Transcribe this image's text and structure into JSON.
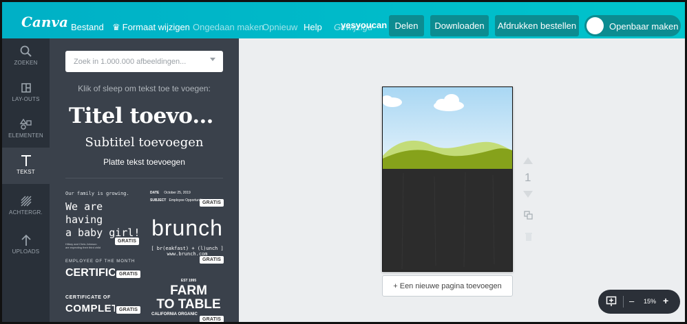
{
  "app": {
    "logo": "Canva"
  },
  "menu": {
    "file": "Bestand",
    "resize": "Formaat wijzigen",
    "undo": "Ongedaan maken",
    "redo": "Opnieuw",
    "help": "Help",
    "saved_status": "Gewijzigd",
    "user": "yesyoucan"
  },
  "toolbar": {
    "share": "Delen",
    "download": "Downloaden",
    "print": "Afdrukken bestellen",
    "make_public": "Openbaar maken"
  },
  "rail": [
    {
      "label": "ZOEKEN",
      "icon": "search-icon"
    },
    {
      "label": "LAY-OUTS",
      "icon": "layout-icon"
    },
    {
      "label": "ELEMENTEN",
      "icon": "shapes-icon"
    },
    {
      "label": "TEKST",
      "icon": "text-icon"
    },
    {
      "label": "ACHTERGR.",
      "icon": "background-icon"
    },
    {
      "label": "UPLOADS",
      "icon": "upload-icon"
    }
  ],
  "panel": {
    "search_placeholder": "Zoek in 1.000.000 afbeeldingen...",
    "hint": "Klik of sleep om tekst toe te voegen:",
    "add_title": "Titel toevoegen",
    "add_subtitle": "Subtitel toevoegen",
    "add_body": "Platte tekst toevoegen",
    "badge": "GRATIS",
    "templates": {
      "baby": {
        "line1": "Our family is growing.",
        "line2": "We are having",
        "line3": "a baby girl!",
        "small1": "Hillary and Chris Johnson",
        "small2": "are expecting their third child"
      },
      "memo": {
        "date_label": "DATE",
        "date_value": "October 25, 2019",
        "subject_label": "SUBJECT",
        "subject_value": "Employee Opportunities"
      },
      "brunch": {
        "title": "brunch",
        "line1": "[ br(eakfast) + (l)unch ]",
        "line2": "www.brunch.com"
      },
      "employee": {
        "line1": "EMPLOYEE OF THE MONTH",
        "line2": "CERTIFICATE"
      },
      "completion": {
        "line1": "CERTIFICATE OF",
        "line2": "COMPLETION"
      },
      "farm": {
        "est": "EST 1995",
        "line1": "FARM",
        "line2": "TO TABLE",
        "line3": "CALIFORNIA ORGANIC"
      }
    }
  },
  "canvas": {
    "page_number": "1",
    "add_page": "+ Een nieuwe pagina toevoegen"
  },
  "zoom": {
    "minus": "–",
    "value": "15%",
    "plus": "+"
  },
  "colors": {
    "accent": "#00c4cc",
    "button": "#0c8c91",
    "rail": "#293039",
    "panel": "#3a414b",
    "sky": "#cfe9f7",
    "grass": "#86a21b"
  }
}
